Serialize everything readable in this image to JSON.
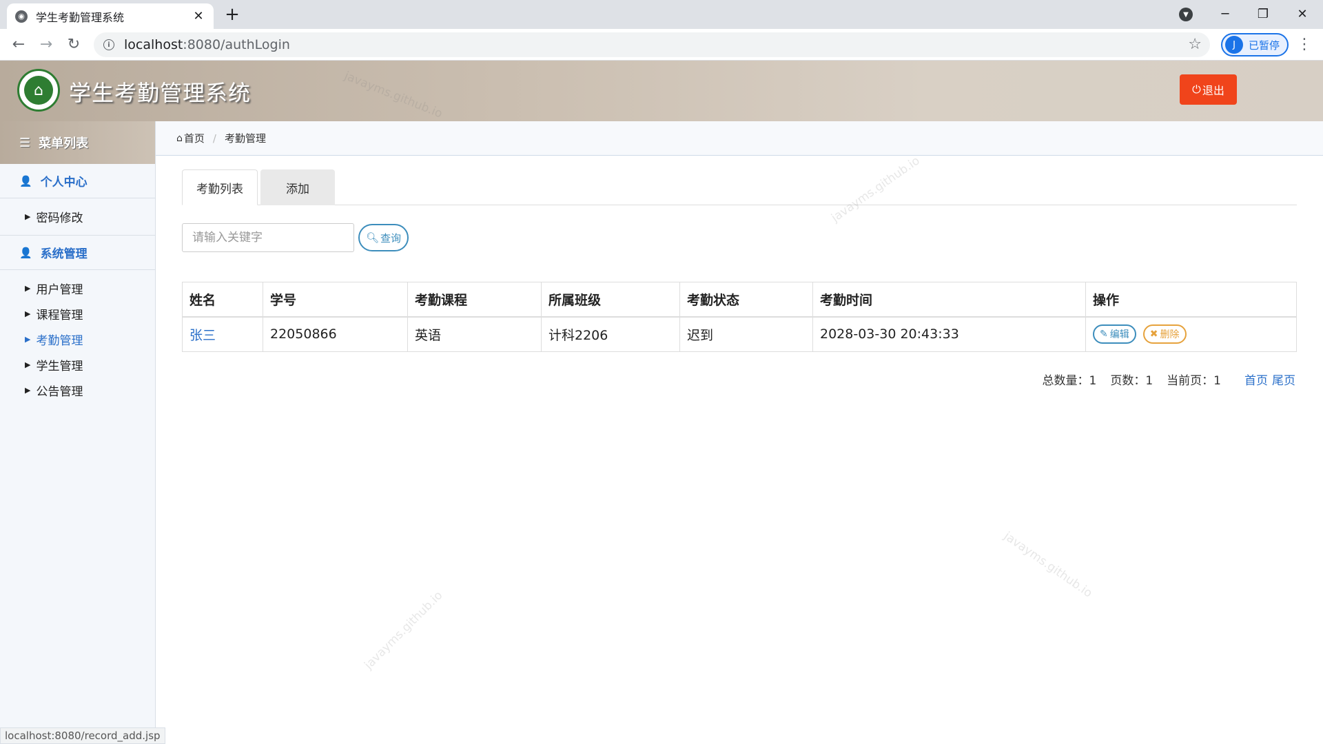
{
  "browser": {
    "tab_title": "学生考勤管理系统",
    "url_host": "localhost",
    "url_rest": ":8080/authLogin",
    "profile_initial": "J",
    "profile_status": "已暂停",
    "status_url": "localhost:8080/record_add.jsp"
  },
  "header": {
    "app_title": "学生考勤管理系统",
    "logout_label": "退出"
  },
  "sidebar": {
    "menu_title": "菜单列表",
    "groups": [
      {
        "title": "个人中心",
        "items": [
          "密码修改"
        ]
      },
      {
        "title": "系统管理",
        "items": [
          "用户管理",
          "课程管理",
          "考勤管理",
          "学生管理",
          "公告管理"
        ]
      }
    ],
    "active_item": "考勤管理"
  },
  "breadcrumb": {
    "home": "首页",
    "current": "考勤管理"
  },
  "tabs": [
    "考勤列表",
    "添加"
  ],
  "search": {
    "placeholder": "请输入关键字",
    "button_label": "查询"
  },
  "table": {
    "headers": [
      "姓名",
      "学号",
      "考勤课程",
      "所属班级",
      "考勤状态",
      "考勤时间",
      "操作"
    ],
    "rows": [
      {
        "name": "张三",
        "student_id": "22050866",
        "course": "英语",
        "class": "计科2206",
        "status": "迟到",
        "time": "2028-03-30 20:43:33"
      }
    ],
    "edit_label": "编辑",
    "delete_label": "删除"
  },
  "pager": {
    "total": "总数量：1",
    "pages": "页数：1",
    "current": "当前页：1",
    "first": "首页",
    "last": "尾页"
  },
  "watermark": "javayms.github.io",
  "colors": {
    "accent": "#2a6fc9",
    "logout": "#f0441b",
    "edit": "#3c8dbc",
    "delete": "#e6a23c"
  }
}
